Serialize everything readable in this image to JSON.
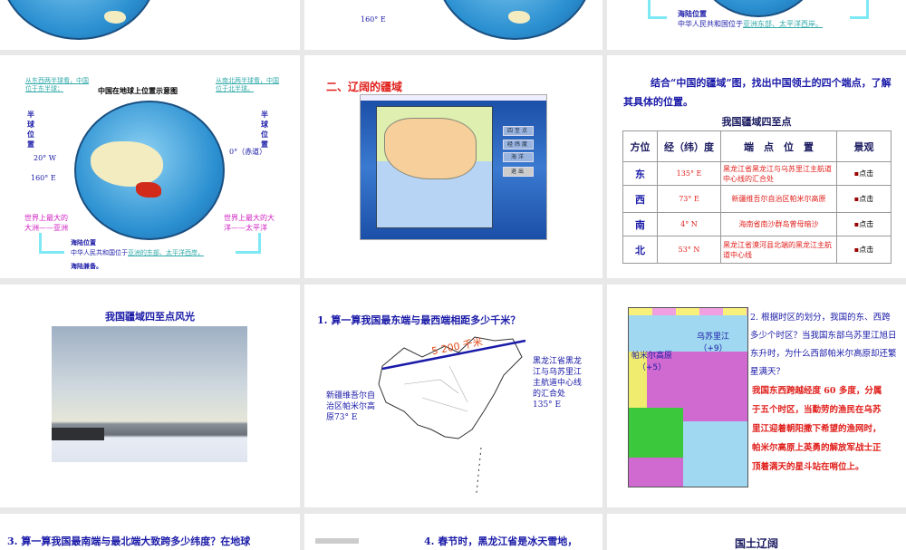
{
  "slide_r1_c2": {
    "lon_label": "160° E"
  },
  "slide_r1_c3": {
    "heading": "海陆位置",
    "text": "中华人民共和国位于",
    "link": "亚洲东部、太平洋西岸。"
  },
  "slide_globe": {
    "title": "中国在地球上位置示意图",
    "left_note": "从东西两半球看，中国位于东半球；",
    "right_note": "从南北两半球看，中国位于北半球。",
    "hemi_left": "半球位置",
    "hemi_right": "半球位置",
    "lon1": "20° W",
    "lon2": "160° E",
    "equator": "0°（赤道）",
    "continent": "世界上最大的大洲——亚洲",
    "ocean": "世界上最大的大洋——太平洋",
    "sea_land_heading": "海陆位置",
    "sea_land_text": "中华人民共和国位于",
    "sea_land_link": "亚洲的东部、太平洋西岸，",
    "sea_land_tail": "海陆兼备。"
  },
  "slide_territory": {
    "title": "二、辽阔的疆域",
    "buttons": [
      "四至点",
      "经纬度",
      "海洋",
      "退出"
    ]
  },
  "slide_table": {
    "intro": "结合“中国的疆域”图，找出中国领土的四个端点，了解其具体的位置。",
    "table_title": "我国疆域四至点",
    "headers": [
      "方位",
      "经（纬）度",
      "端　点　位　置",
      "景观"
    ],
    "rows": [
      {
        "dir": "东",
        "coord": "135° E",
        "place": "黑龙江省黑龙江与乌苏里江主航道中心线的汇合处",
        "link": "点击"
      },
      {
        "dir": "西",
        "coord": "73° E",
        "place": "新疆维吾尔自治区帕米尔高原",
        "link": "点击"
      },
      {
        "dir": "南",
        "coord": "4° N",
        "place": "海南省南沙群岛曾母暗沙",
        "link": "点击"
      },
      {
        "dir": "北",
        "coord": "53° N",
        "place": "黑龙江省漠河县北端的黑龙江主航道中心线",
        "link": "点击"
      }
    ]
  },
  "slide_scenery": {
    "title": "我国疆域四至点风光"
  },
  "slide_distance": {
    "question": "1. 算一算我国最东端与最西端相距多少千米？",
    "distance": "5 200 千米",
    "west": "新疆维吾尔自治区帕米尔高原73° E",
    "east": "黑龙江省黑龙江与乌苏里江主航道中心线的汇合处 135° E"
  },
  "slide_timezone": {
    "question": "2. 根据时区的划分，我国的东、西跨多少个时区？当我国东部乌苏里江旭日东升时，为什么西部帕米尔高原却还繁星满天？",
    "map_east": "乌苏里江（+9）",
    "map_west": "帕米尔高原（+5）",
    "answer": "我国东西跨越经度 60 多度，分属于五个时区，当勤劳的渔民在乌苏里江迎着朝阳撒下希望的渔网时，帕米尔高原上英勇的解放军战士正顶着满天的星斗站在哨位上。"
  },
  "row4": [
    "3. 算一算我国最南端与最北端大致跨多少纬度？在地球",
    "4. 春节时，黑龙江省是冰天雪地，",
    "国土辽阔"
  ],
  "colors": {
    "blue": "#1a1aa8",
    "red": "#e0201c",
    "gap": "#e8e8e8"
  }
}
